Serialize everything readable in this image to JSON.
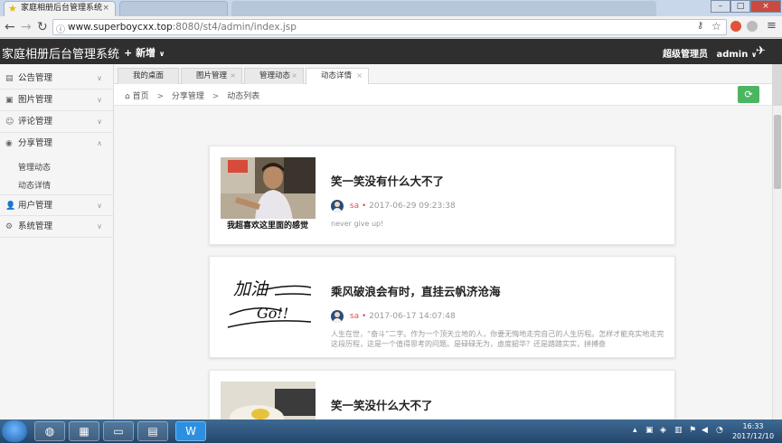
{
  "browser": {
    "tabs": [
      {
        "title": "家庭相册后台管理系统"
      },
      {
        "title": ""
      }
    ],
    "url_host": "www.superboycxx.top",
    "url_path": ":8080/st4/admin/index.jsp"
  },
  "header": {
    "title": "家庭相册后台管理系统",
    "new_label": "新增",
    "role": "超级管理员",
    "user": "admin"
  },
  "sidebar": {
    "items": [
      {
        "label": "公告管理"
      },
      {
        "label": "图片管理"
      },
      {
        "label": "评论管理"
      },
      {
        "label": "分享管理"
      },
      {
        "label": "用户管理"
      },
      {
        "label": "系统管理"
      }
    ],
    "subitems": [
      {
        "label": "管理动态"
      },
      {
        "label": "动态详情"
      }
    ]
  },
  "page_tabs": [
    {
      "label": "我的桌面"
    },
    {
      "label": "图片管理"
    },
    {
      "label": "管理动态"
    },
    {
      "label": "动态详情"
    }
  ],
  "breadcrumb": {
    "home": "首页",
    "level1": "分享管理",
    "level2": "动态列表"
  },
  "posts": [
    {
      "title": "笑一笑没有什么大不了",
      "author": "sa",
      "time": "2017-06-29 09:23:38",
      "desc": "never give up!",
      "thumb_caption": "我超喜欢这里面的感觉"
    },
    {
      "title": "乘风破浪会有时，直挂云帆济沧海",
      "author": "sa",
      "time": "2017-06-17 14:07:48",
      "desc": "人生在世，“奋斗”二字。作为一个顶天立地的人，你要无悔地走完自己的人生历程。怎样才能充实地走完这段历程，这是一个值得思考的问题。是碌碌无为，虚度韶华？还是踏踏实实，拼搏奋",
      "thumb_text1": "加油",
      "thumb_text2": "Go!!"
    },
    {
      "title": "笑一笑没什么大不了"
    }
  ],
  "taskbar": {
    "time": "16:33",
    "date": "2017/12/10"
  }
}
